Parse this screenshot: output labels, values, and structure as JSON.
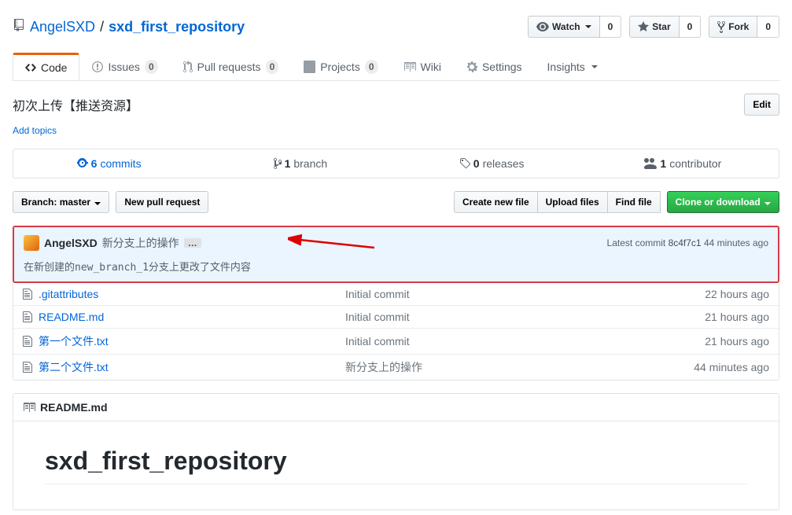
{
  "repo": {
    "owner": "AngelSXD",
    "name": "sxd_first_repository"
  },
  "actions": {
    "watch": {
      "label": "Watch",
      "count": "0"
    },
    "star": {
      "label": "Star",
      "count": "0"
    },
    "fork": {
      "label": "Fork",
      "count": "0"
    }
  },
  "tabs": {
    "code": "Code",
    "issues": {
      "label": "Issues",
      "count": "0"
    },
    "pulls": {
      "label": "Pull requests",
      "count": "0"
    },
    "projects": {
      "label": "Projects",
      "count": "0"
    },
    "wiki": "Wiki",
    "settings": "Settings",
    "insights": "Insights"
  },
  "description": "初次上传【推送资源】",
  "edit_label": "Edit",
  "add_topics": "Add topics",
  "stats": {
    "commits": {
      "num": "6",
      "label": "commits"
    },
    "branches": {
      "num": "1",
      "label": "branch"
    },
    "releases": {
      "num": "0",
      "label": "releases"
    },
    "contributors": {
      "num": "1",
      "label": "contributor"
    }
  },
  "file_bar": {
    "branch_btn_prefix": "Branch: ",
    "branch_btn_value": "master",
    "new_pr": "New pull request",
    "create_file": "Create new file",
    "upload": "Upload files",
    "find": "Find file",
    "clone": "Clone or download"
  },
  "commit_tease": {
    "author": "AngelSXD",
    "message": "新分支上的操作",
    "sub": "在新创建的new_branch_1分支上更改了文件内容",
    "meta_prefix": "Latest commit ",
    "sha": "8c4f7c1",
    "time": " 44 minutes ago"
  },
  "files": [
    {
      "name": ".gitattributes",
      "msg": "Initial commit",
      "age": "22 hours ago"
    },
    {
      "name": "README.md",
      "msg": "Initial commit",
      "age": "21 hours ago"
    },
    {
      "name": "第一个文件.txt",
      "msg": "Initial commit",
      "age": "21 hours ago"
    },
    {
      "name": "第二个文件.txt",
      "msg": "新分支上的操作",
      "age": "44 minutes ago"
    }
  ],
  "readme": {
    "filename": "README.md",
    "heading": "sxd_first_repository"
  }
}
